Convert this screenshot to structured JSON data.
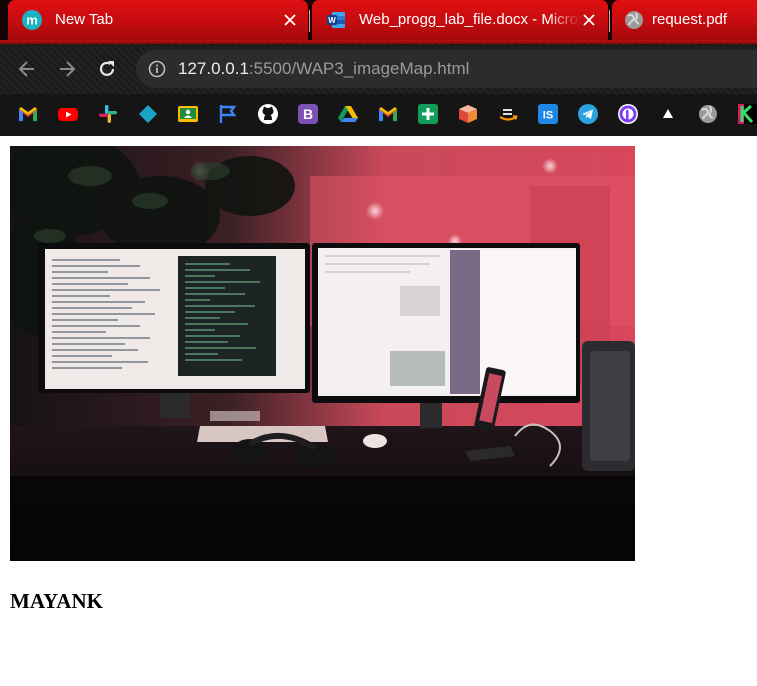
{
  "browser": {
    "tabs": [
      {
        "title": "New Tab",
        "icon": "m-avatar-icon",
        "active": true
      },
      {
        "title": "Web_progg_lab_file.docx - Microsoft Word Online",
        "icon": "word-icon"
      },
      {
        "title": "request.pdf",
        "icon": "globe-icon"
      }
    ],
    "address": {
      "host": "127.0.0.1",
      "rest": ":5500/WAP3_imageMap.html"
    },
    "bookmarks": [
      "gmail-icon",
      "youtube-icon",
      "slack-icon",
      "diamond-icon",
      "google-classroom-icon",
      "flag-icon",
      "github-icon",
      "bootstrap-icon",
      "google-drive-icon",
      "gmail-icon",
      "google-sheets-icon",
      "cube-icon",
      "amazon-icon",
      "is-icon",
      "telegram-icon",
      "p-icon",
      "triangle-icon",
      "globe-icon",
      "k-icon"
    ],
    "theme": {
      "accent": "#d30f12",
      "toolbar": "#1b1b1b"
    }
  },
  "page": {
    "image": {
      "description_icon": "desk-setup-image"
    },
    "heading": "MAYANK"
  }
}
